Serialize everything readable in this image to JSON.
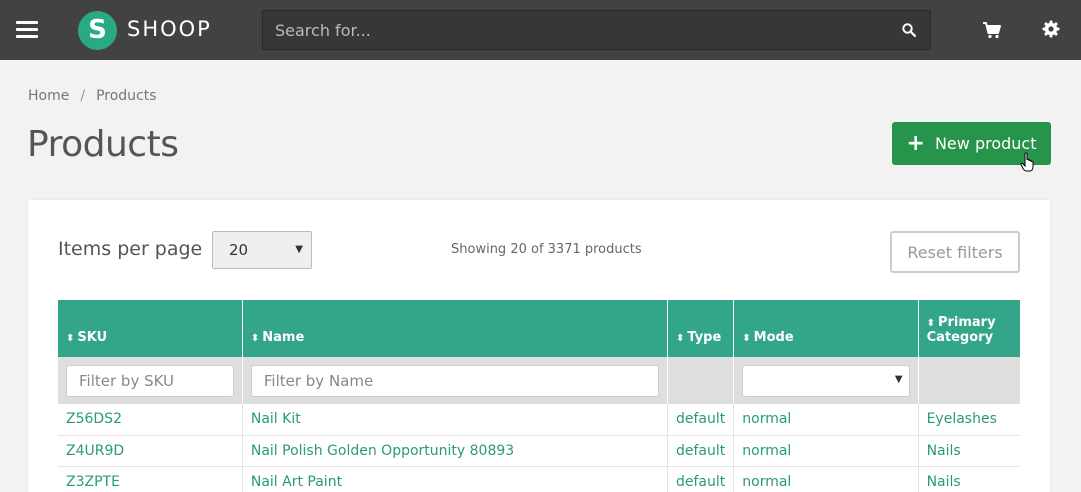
{
  "topbar": {
    "logo_letter": "S",
    "logo_text": "SHOOP",
    "search_placeholder": "Search for...",
    "icons": [
      "hamburger-icon",
      "search-icon",
      "cart-icon",
      "gear-icon"
    ]
  },
  "breadcrumb": {
    "items": [
      "Home",
      "Products"
    ],
    "separator": "/"
  },
  "page": {
    "title": "Products",
    "new_button_label": "New product"
  },
  "list_controls": {
    "items_per_page_label": "Items per page",
    "items_per_page_value": "20",
    "showing_text": "Showing 20 of 3371 products",
    "reset_filters_label": "Reset filters"
  },
  "table": {
    "columns": [
      {
        "label": "SKU"
      },
      {
        "label": "Name"
      },
      {
        "label": "Type"
      },
      {
        "label": "Mode"
      },
      {
        "label_line1": "Primary",
        "label_line2": "Category"
      }
    ],
    "filters": {
      "sku_placeholder": "Filter by SKU",
      "name_placeholder": "Filter by Name",
      "mode_value": ""
    },
    "rows": [
      {
        "sku": "Z56DS2",
        "name": "Nail Kit",
        "type": "default",
        "mode": "normal",
        "category": "Eyelashes"
      },
      {
        "sku": "Z4UR9D",
        "name": "Nail Polish Golden Opportunity 80893",
        "type": "default",
        "mode": "normal",
        "category": "Nails"
      },
      {
        "sku": "Z3ZPTE",
        "name": "Nail Art Paint",
        "type": "default",
        "mode": "normal",
        "category": "Nails"
      }
    ]
  },
  "colors": {
    "topbar": "#424242",
    "brand": "#2aa986",
    "primary_button": "#27944b",
    "table_header": "#33a589",
    "link": "#2a9a7a"
  }
}
